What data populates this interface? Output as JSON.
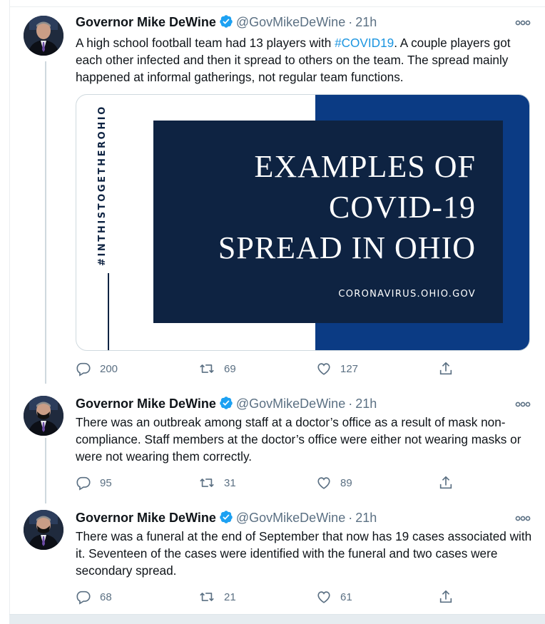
{
  "tweets": [
    {
      "name": "Governor Mike DeWine",
      "handle": "@GovMikeDeWine",
      "time": "21h",
      "text_before": "A high school football team had 13 players with ",
      "hashtag": "#COVID19",
      "text_after": ". A couple players got each other infected and then it spread to others on the team. The spread mainly happened at informal gatherings, not regular team functions.",
      "media": {
        "vertical_tag": "#INTHISTOGETHEROHIO",
        "headline_1": "EXAMPLES OF",
        "headline_2": "COVID-19",
        "headline_3": "SPREAD IN OHIO",
        "site": "CORONAVIRUS.OHIO.GOV"
      },
      "replies": "200",
      "retweets": "69",
      "likes": "127"
    },
    {
      "name": "Governor Mike DeWine",
      "handle": "@GovMikeDeWine",
      "time": "21h",
      "text": "There was an outbreak among staff at a doctor’s office as a result of mask non-compliance. Staff members at the doctor’s office were either not wearing masks or were not wearing them correctly.",
      "replies": "95",
      "retweets": "31",
      "likes": "89"
    },
    {
      "name": "Governor Mike DeWine",
      "handle": "@GovMikeDeWine",
      "time": "21h",
      "text": "There was a funeral at the end of September that now has 19 cases associated with it. Seventeen of the cases were identified with the funeral and two cases were secondary spread.",
      "replies": "68",
      "retweets": "21",
      "likes": "61"
    }
  ],
  "separator": "·",
  "colors": {
    "accent": "#1da1f2",
    "muted": "#5b7083",
    "media_blue": "#0b3b84",
    "media_navy": "#0e2342"
  },
  "icons": [
    "verified-badge-icon",
    "more-options-icon",
    "reply-icon",
    "retweet-icon",
    "like-icon",
    "share-icon"
  ]
}
